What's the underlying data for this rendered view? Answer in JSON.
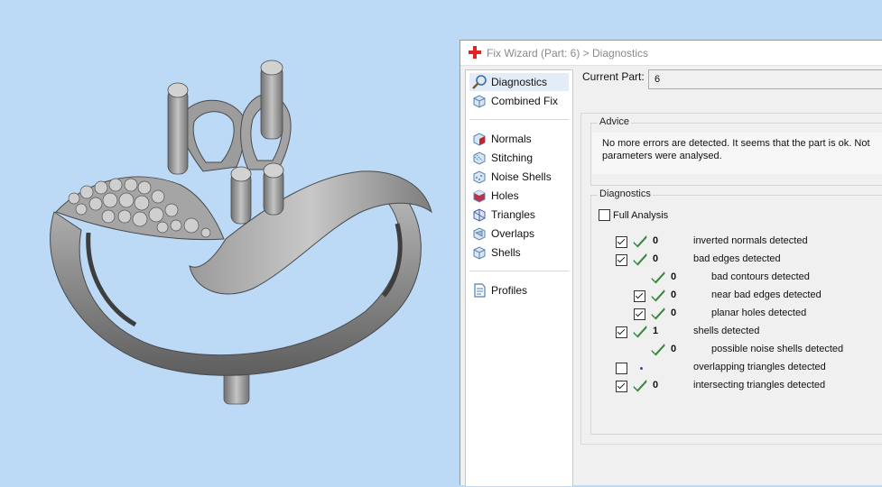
{
  "window": {
    "title": "Fix Wizard (Part: 6) > Diagnostics"
  },
  "nav": {
    "top_items": [
      {
        "label": "Diagnostics",
        "icon": "magnifier-icon",
        "selected": true
      },
      {
        "label": "Combined Fix",
        "icon": "cube-icon",
        "selected": false
      }
    ],
    "fix_items": [
      {
        "label": "Normals",
        "icon": "normals-cube-icon"
      },
      {
        "label": "Stitching",
        "icon": "stitching-cube-icon"
      },
      {
        "label": "Noise Shells",
        "icon": "noise-shells-cube-icon"
      },
      {
        "label": "Holes",
        "icon": "holes-cube-icon"
      },
      {
        "label": "Triangles",
        "icon": "triangles-cube-icon"
      },
      {
        "label": "Overlaps",
        "icon": "overlaps-cube-icon"
      },
      {
        "label": "Shells",
        "icon": "shells-cube-icon"
      }
    ],
    "profiles_label": "Profiles"
  },
  "current_part": {
    "label": "Current Part:",
    "value": "6"
  },
  "advice": {
    "title": "Advice",
    "text": "No more errors are detected. It seems that the part is ok. Not parameters were analysed."
  },
  "diagnostics": {
    "title": "Diagnostics",
    "full_analysis_label": "Full Analysis",
    "full_analysis_checked": false,
    "rows": [
      {
        "checkbox": true,
        "checked": true,
        "status": "ok",
        "count": "0",
        "label": "inverted normals detected",
        "indent": 0
      },
      {
        "checkbox": true,
        "checked": true,
        "status": "ok",
        "count": "0",
        "label": "bad edges detected",
        "indent": 0
      },
      {
        "checkbox": false,
        "checked": false,
        "status": "ok",
        "count": "0",
        "label": "bad contours detected",
        "indent": 1
      },
      {
        "checkbox": true,
        "checked": true,
        "status": "ok",
        "count": "0",
        "label": "near bad edges detected",
        "indent": 1
      },
      {
        "checkbox": true,
        "checked": true,
        "status": "ok",
        "count": "0",
        "label": "planar holes detected",
        "indent": 1
      },
      {
        "checkbox": true,
        "checked": true,
        "status": "ok",
        "count": "1",
        "label": "shells detected",
        "indent": 0
      },
      {
        "checkbox": false,
        "checked": false,
        "status": "ok",
        "count": "0",
        "label": "possible noise shells detected",
        "indent": 1
      },
      {
        "checkbox": true,
        "checked": false,
        "status": "pending",
        "count": "",
        "label": "overlapping triangles detected",
        "indent": 0
      },
      {
        "checkbox": true,
        "checked": true,
        "status": "ok",
        "count": "0",
        "label": "intersecting triangles detected",
        "indent": 0
      }
    ]
  },
  "colors": {
    "viewport_background": "#bcdaf6",
    "check_green": "#2e8b3a",
    "model_gray": "#8c8c8c"
  }
}
